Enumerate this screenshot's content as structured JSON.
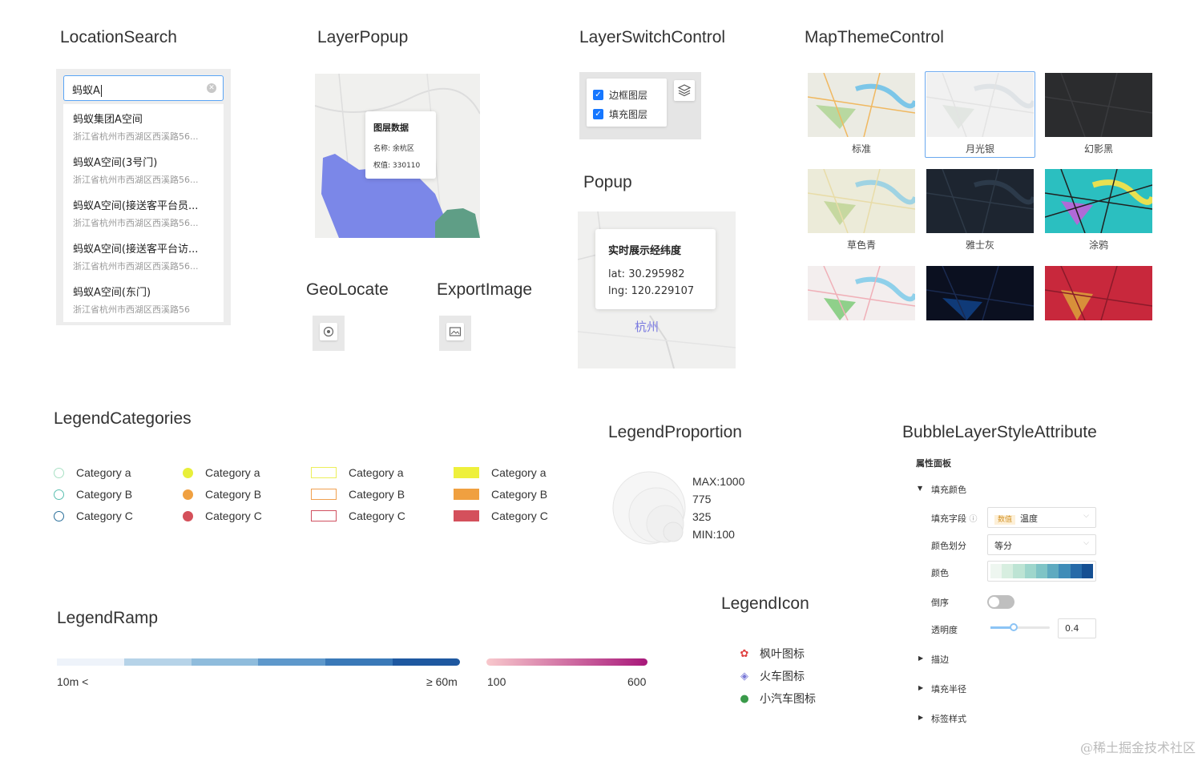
{
  "titles": {
    "location_search": "LocationSearch",
    "layer_popup": "LayerPopup",
    "layer_switch": "LayerSwitchControl",
    "map_theme": "MapThemeControl",
    "popup": "Popup",
    "geolocate": "GeoLocate",
    "export_image": "ExportImage",
    "legend_categories": "LegendCategories",
    "legend_proportion": "LegendProportion",
    "bubble_layer": "BubbleLayerStyleAttribute",
    "legend_ramp": "LegendRamp",
    "legend_icon": "LegendIcon"
  },
  "location_search": {
    "value": "蚂蚁A",
    "results": [
      {
        "name": "蚂蚁集团A空间",
        "address": "浙江省杭州市西湖区西溪路56..."
      },
      {
        "name": "蚂蚁A空间(3号门)",
        "address": "浙江省杭州市西湖区西溪路56..."
      },
      {
        "name": "蚂蚁A空间(接送客平台员...",
        "address": "浙江省杭州市西湖区西溪路56..."
      },
      {
        "name": "蚂蚁A空间(接送客平台访...",
        "address": "浙江省杭州市西湖区西溪路56..."
      },
      {
        "name": "蚂蚁A空间(东门)",
        "address": "浙江省杭州市西湖区西溪路56"
      }
    ]
  },
  "layer_popup": {
    "title": "图层数据",
    "name_row": "名称: 余杭区",
    "weight_row": "权值: 330110"
  },
  "layer_switch": {
    "items": [
      {
        "label": "边框图层",
        "checked": true
      },
      {
        "label": "填充图层",
        "checked": true
      }
    ]
  },
  "map_themes": [
    {
      "label": "标准",
      "selected": false
    },
    {
      "label": "月光银",
      "selected": true
    },
    {
      "label": "幻影黑",
      "selected": false
    },
    {
      "label": "草色青",
      "selected": false
    },
    {
      "label": "雅士灰",
      "selected": false
    },
    {
      "label": "涂鸦",
      "selected": false
    },
    {
      "label": "",
      "selected": false
    },
    {
      "label": "",
      "selected": false
    },
    {
      "label": "",
      "selected": false
    }
  ],
  "popup": {
    "title": "实时展示经纬度",
    "lat": "lat: 30.295982",
    "lng": "lng: 120.229107",
    "city": "杭州"
  },
  "legend_categories": {
    "groups": [
      {
        "style": "hollow-circle",
        "colors": [
          "#a8e0c4",
          "#5bbfb0",
          "#2a6f9a"
        ],
        "labels": [
          "Category a",
          "Category B",
          "Category C"
        ]
      },
      {
        "style": "filled-circle",
        "colors": [
          "#e8ef3a",
          "#f0a040",
          "#d4505a"
        ],
        "labels": [
          "Category a",
          "Category B",
          "Category C"
        ]
      },
      {
        "style": "hollow-rect",
        "colors": [
          "#ecef5a",
          "#f0a050",
          "#d05060"
        ],
        "labels": [
          "Category a",
          "Category B",
          "Category C"
        ]
      },
      {
        "style": "filled-rect",
        "colors": [
          "#eef03c",
          "#f0a040",
          "#d4505c"
        ],
        "labels": [
          "Category a",
          "Category B",
          "Category C"
        ]
      }
    ]
  },
  "legend_proportion": {
    "labels": [
      "MAX:1000",
      "775",
      "325",
      "MIN:100"
    ]
  },
  "bubble_panel": {
    "title": "属性面板",
    "fill_color": "填充颜色",
    "fill_field_label": "填充字段",
    "field_tag": "数值",
    "field_value": "温度",
    "division_label": "颜色划分",
    "division_value": "等分",
    "color_label": "颜色",
    "palette": [
      "#eef6f0",
      "#d7eee0",
      "#bde4d4",
      "#9ed6cc",
      "#7fc4c6",
      "#5eaac0",
      "#3f8cb8",
      "#266aa8",
      "#154f92"
    ],
    "reverse_label": "倒序",
    "opacity_label": "透明度",
    "opacity_value": "0.4",
    "stroke": "描边",
    "radius": "填充半径",
    "label_style": "标签样式"
  },
  "legend_ramp": {
    "ramp1": {
      "start": "10m <",
      "end": "≥ 60m",
      "colors": [
        "#eef3fa",
        "#b6d3e8",
        "#8fbcdc",
        "#5e98cb",
        "#3a79b8",
        "#1e58a0"
      ]
    },
    "ramp2": {
      "start": "100",
      "end": "600",
      "colors": [
        "#f8c8cc",
        "#a8187a"
      ]
    }
  },
  "legend_icon": {
    "items": [
      {
        "icon": "maple-leaf-icon",
        "label": "枫叶图标"
      },
      {
        "icon": "train-icon",
        "label": "火车图标"
      },
      {
        "icon": "car-icon",
        "label": "小汽车图标"
      }
    ]
  },
  "watermark": "@稀土掘金技术社区"
}
